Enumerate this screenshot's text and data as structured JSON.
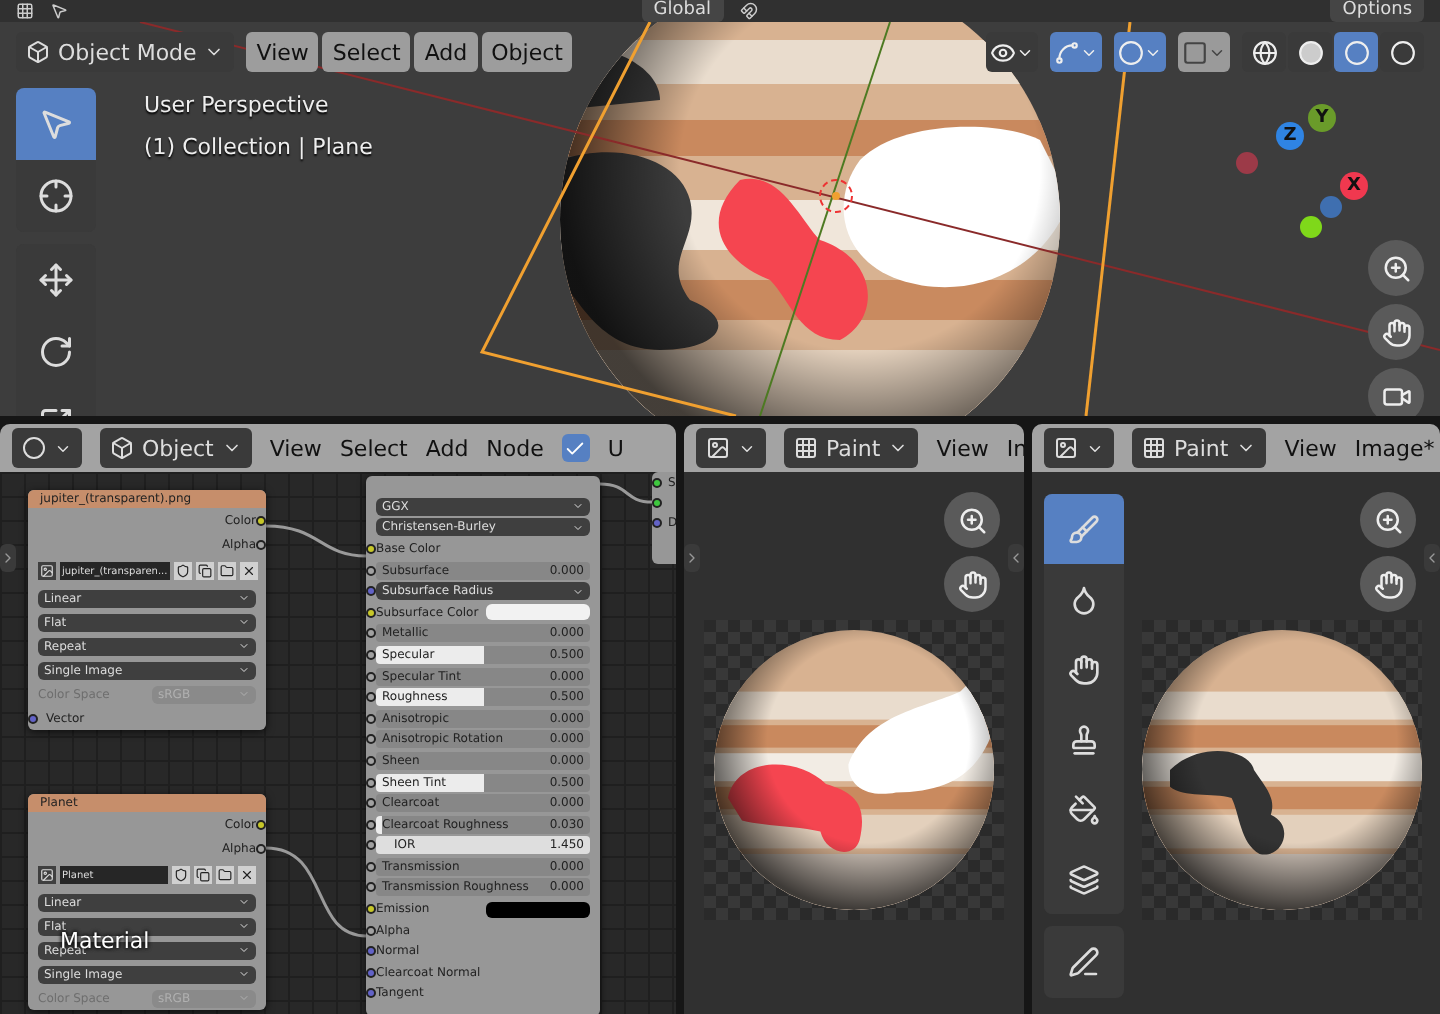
{
  "viewport": {
    "header_strip": {
      "orientation": "Global",
      "options": "Options"
    },
    "mode": "Object Mode",
    "menus": [
      "View",
      "Select",
      "Add",
      "Object"
    ],
    "info": [
      "User Perspective",
      "(1) Collection | Plane"
    ],
    "tools": [
      {
        "kind": "select",
        "selected": true
      },
      {
        "kind": "cursor",
        "selected": false
      },
      {
        "kind": "move",
        "selected": false
      },
      {
        "kind": "rotate",
        "selected": false
      },
      {
        "kind": "scale",
        "selected": false
      }
    ],
    "overlays": [
      {
        "kind": "visibility",
        "on": false
      },
      {
        "kind": "gizmo",
        "on": true
      },
      {
        "kind": "overlay",
        "on": true
      },
      {
        "kind": "xray",
        "on": false
      }
    ],
    "shading": [
      {
        "kind": "wireframe",
        "selected": false
      },
      {
        "kind": "solid",
        "selected": false
      },
      {
        "kind": "material",
        "selected": true
      },
      {
        "kind": "rendered",
        "selected": false
      }
    ],
    "axes": [
      {
        "label": "X",
        "color": "#f0384f"
      },
      {
        "label": "Y",
        "color": "#6a9b2a"
      },
      {
        "label": "Z",
        "color": "#2f84e3"
      }
    ],
    "navigation": [
      {
        "kind": "zoom"
      },
      {
        "kind": "pan"
      },
      {
        "kind": "camera"
      }
    ]
  },
  "node_editor": {
    "editor_type": "Object",
    "menus": [
      "View",
      "Select",
      "Add",
      "Node"
    ],
    "use_nodes": {
      "label": "U",
      "checked": true
    },
    "label": "Material",
    "nodes": [
      {
        "kind": "image",
        "title": "jupiter_(transparent).png",
        "outputs": [
          "Color",
          "Alpha"
        ],
        "image_name": "jupiter_(transparen...",
        "fields": [
          "Linear",
          "Flat",
          "Repeat",
          "Single Image"
        ],
        "color_space": {
          "label": "Color Space",
          "value": "sRGB",
          "disabled": true
        },
        "inputs": [
          "Vector"
        ]
      },
      {
        "kind": "image",
        "title": "Planet",
        "outputs": [
          "Color",
          "Alpha"
        ],
        "image_name": "Planet",
        "fields": [
          "Linear",
          "Flat",
          "Repeat",
          "Single Image"
        ],
        "color_space": {
          "label": "Color Space",
          "value": "sRGB",
          "disabled": true
        }
      },
      {
        "kind": "bsdf",
        "rows": [
          {
            "kind": "dropdown",
            "label": "GGX"
          },
          {
            "kind": "dropdown",
            "label": "Christensen-Burley"
          },
          {
            "kind": "socket",
            "label": "Base Color",
            "color": "#c7c729"
          },
          {
            "kind": "slider",
            "label": "Subsurface",
            "value": "0.000",
            "level": 0,
            "color": "#a1a1a1"
          },
          {
            "kind": "dropdown",
            "label": "Subsurface Radius",
            "color": "#6363c7"
          },
          {
            "kind": "swatch",
            "label": "Subsurface Color",
            "color": "#f2f2f2"
          },
          {
            "kind": "slider",
            "label": "Metallic",
            "value": "0.000",
            "level": 0,
            "color": "#a1a1a1"
          },
          {
            "kind": "slider",
            "label": "Specular",
            "value": "0.500",
            "level": 0.5,
            "color": "#a1a1a1"
          },
          {
            "kind": "slider",
            "label": "Specular Tint",
            "value": "0.000",
            "level": 0,
            "color": "#a1a1a1"
          },
          {
            "kind": "slider",
            "label": "Roughness",
            "value": "0.500",
            "level": 0.5,
            "color": "#a1a1a1"
          },
          {
            "kind": "slider",
            "label": "Anisotropic",
            "value": "0.000",
            "level": 0,
            "color": "#a1a1a1"
          },
          {
            "kind": "slider",
            "label": "Anisotropic Rotation",
            "value": "0.000",
            "level": 0,
            "color": "#a1a1a1"
          },
          {
            "kind": "slider",
            "label": "Sheen",
            "value": "0.000",
            "level": 0,
            "color": "#a1a1a1"
          },
          {
            "kind": "slider",
            "label": "Sheen Tint",
            "value": "0.500",
            "level": 0.5,
            "color": "#a1a1a1"
          },
          {
            "kind": "slider",
            "label": "Clearcoat",
            "value": "0.000",
            "level": 0,
            "color": "#a1a1a1"
          },
          {
            "kind": "slider",
            "label": "Clearcoat Roughness",
            "value": "0.030",
            "level": 0.03,
            "color": "#a1a1a1"
          },
          {
            "kind": "number",
            "label": "IOR",
            "value": "1.450",
            "color": "#a1a1a1"
          },
          {
            "kind": "slider",
            "label": "Transmission",
            "value": "0.000",
            "level": 0,
            "color": "#a1a1a1"
          },
          {
            "kind": "slider",
            "label": "Transmission Roughness",
            "value": "0.000",
            "level": 0,
            "color": "#a1a1a1"
          },
          {
            "kind": "swatch",
            "label": "Emission",
            "color": "#000000"
          },
          {
            "kind": "socket",
            "label": "Alpha",
            "color": "#a1a1a1"
          },
          {
            "kind": "socket",
            "label": "Normal",
            "color": "#6363c7"
          },
          {
            "kind": "socket",
            "label": "Clearcoat Normal",
            "color": "#6363c7"
          },
          {
            "kind": "socket",
            "label": "Tangent",
            "color": "#6363c7"
          }
        ]
      }
    ],
    "partial_node": {
      "sockets": [
        {
          "label": "S",
          "color": "#3fc73f"
        },
        {
          "color": "#3fc73f"
        },
        {
          "label": "D",
          "color": "#6363c7"
        }
      ]
    }
  },
  "image_editors": [
    {
      "mode": "Paint",
      "menus": [
        "View",
        "In"
      ],
      "navigation": [
        {
          "kind": "zoom"
        },
        {
          "kind": "pan"
        }
      ]
    },
    {
      "mode": "Paint",
      "menus": [
        "View",
        "Image*"
      ],
      "navigation": [
        {
          "kind": "zoom"
        },
        {
          "kind": "pan"
        }
      ],
      "tools": [
        {
          "kind": "draw",
          "selected": true
        },
        {
          "kind": "soften",
          "selected": false
        },
        {
          "kind": "smear",
          "selected": false
        },
        {
          "kind": "clone",
          "selected": false
        },
        {
          "kind": "fill",
          "selected": false
        },
        {
          "kind": "mask",
          "selected": false
        },
        {
          "kind": "annotate",
          "selected": false
        }
      ]
    }
  ]
}
